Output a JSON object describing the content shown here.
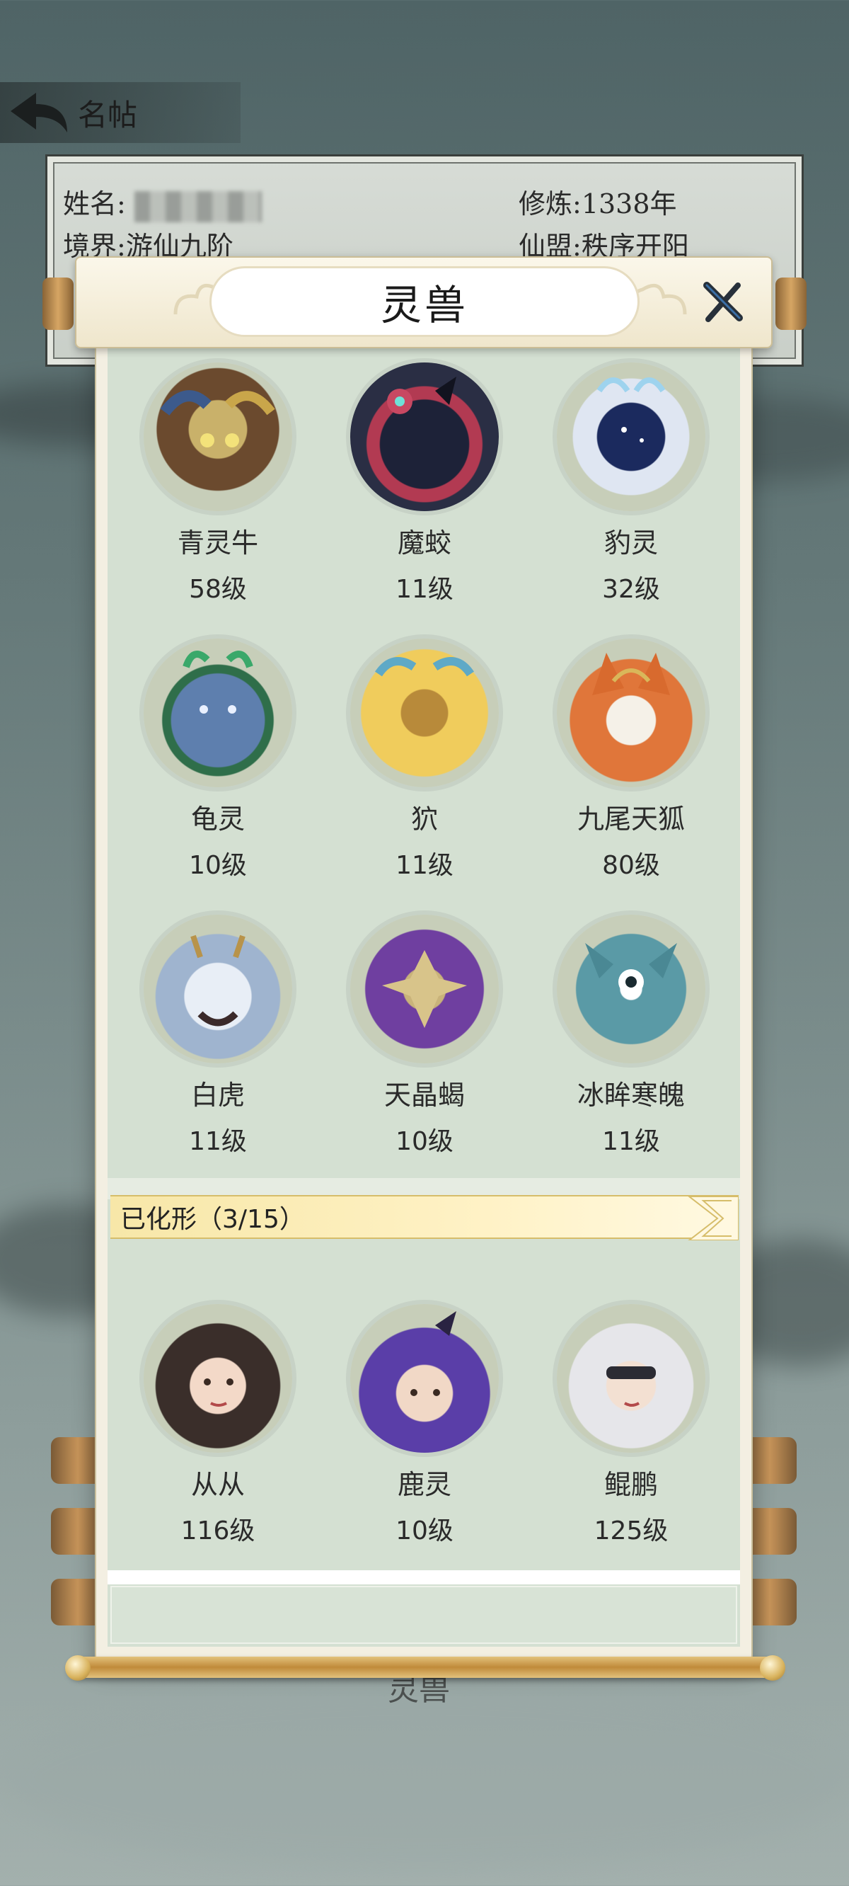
{
  "topbar": {
    "title": "名帖"
  },
  "profile": {
    "name_label": "姓名:",
    "realm_label": "境界:",
    "realm_value": "游仙九阶",
    "cultivation_label": "修炼:",
    "cultivation_value": "1338年",
    "alliance_label": "仙盟:",
    "alliance_value": "秩序开阳"
  },
  "modal": {
    "title": "灵兽",
    "beasts": [
      {
        "name": "青灵牛",
        "level": "58级"
      },
      {
        "name": "魔蛟",
        "level": "11级"
      },
      {
        "name": "豹灵",
        "level": "32级"
      },
      {
        "name": "龟灵",
        "level": "10级"
      },
      {
        "name": "狖",
        "level": "11级"
      },
      {
        "name": "九尾天狐",
        "level": "80级"
      },
      {
        "name": "白虎",
        "level": "11级"
      },
      {
        "name": "天晶蝎",
        "level": "10级"
      },
      {
        "name": "冰眸寒魄",
        "level": "11级"
      }
    ],
    "transformed_section": {
      "label": "已化形（3/15）",
      "beasts": [
        {
          "name": "从从",
          "level": "116级"
        },
        {
          "name": "鹿灵",
          "level": "10级"
        },
        {
          "name": "鲲鹏",
          "level": "125级"
        }
      ]
    }
  },
  "below_modal_text": "灵兽",
  "colors": {
    "panel_bg": "#d4e0d2",
    "banner_gold": "#f7e7a8",
    "frame_cream": "#f3efe2"
  }
}
